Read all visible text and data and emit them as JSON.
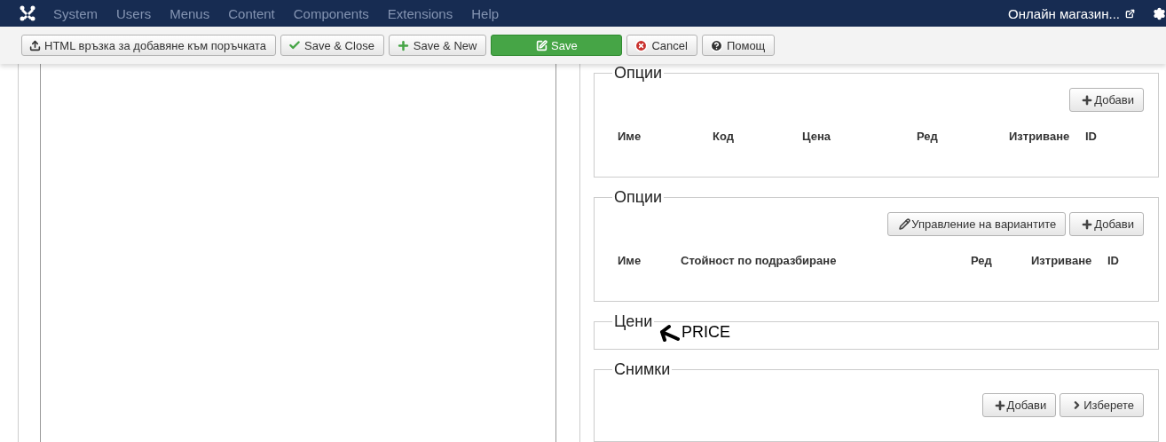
{
  "navbar": {
    "menu": [
      "System",
      "Users",
      "Menus",
      "Content",
      "Components",
      "Extensions",
      "Help"
    ],
    "site_link": "Онлайн магазин..."
  },
  "toolbar": [
    {
      "label": "HTML връзка за добавяне към поръчката",
      "kind": "upload"
    },
    {
      "label": "Save & Close",
      "kind": "check"
    },
    {
      "label": "Save & New",
      "kind": "plus"
    },
    {
      "label": "Save",
      "kind": "save"
    },
    {
      "label": "Cancel",
      "kind": "cancel"
    },
    {
      "label": "Помощ",
      "kind": "help"
    }
  ],
  "sections": [
    {
      "title": "Опции",
      "buttons": [
        {
          "label": "Добави",
          "kind": "add"
        }
      ],
      "columns": [
        "Име",
        "Код",
        "Цена",
        "Ред",
        "Изтриване",
        "ID"
      ]
    },
    {
      "title": "Опции",
      "buttons": [
        {
          "label": "Управление на вариантите",
          "kind": "manage"
        },
        {
          "label": "Добави",
          "kind": "add"
        }
      ],
      "columns": [
        "Име",
        "Стойност по подразбиране",
        "Ред",
        "Изтриване",
        "ID"
      ]
    },
    {
      "title": "Цени",
      "annotation": "PRICE"
    },
    {
      "title": "Снимки",
      "buttons": [
        {
          "label": "Добави",
          "kind": "add"
        },
        {
          "label": "Изберете",
          "kind": "select"
        }
      ]
    }
  ]
}
